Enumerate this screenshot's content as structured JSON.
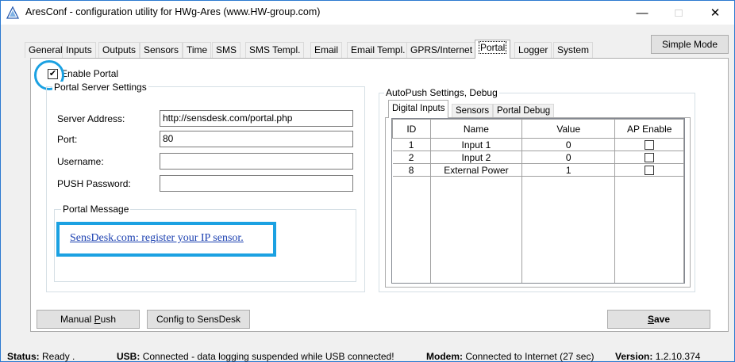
{
  "window": {
    "title": "AresConf - configuration utility for HWg-Ares (www.HW-group.com)"
  },
  "window_controls": {
    "minimize": "—",
    "maximize": "□",
    "close": "✕"
  },
  "tabs": [
    {
      "label": "General"
    },
    {
      "label": "Inputs"
    },
    {
      "label": "Outputs"
    },
    {
      "label": "Sensors"
    },
    {
      "label": "Time"
    },
    {
      "label": "SMS"
    },
    {
      "label": "SMS Templ."
    },
    {
      "label": "Email"
    },
    {
      "label": "Email Templ."
    },
    {
      "label": "GPRS/Internet"
    },
    {
      "label": "Portal",
      "active": true
    },
    {
      "label": "Logger"
    },
    {
      "label": "System"
    }
  ],
  "simple_mode_label": "Simple Mode",
  "portal": {
    "enable_label": "Enable Portal",
    "enable_checked": "☑",
    "server_settings_title": "Portal Server Settings",
    "fields": {
      "server_address": {
        "label": "Server Address:",
        "value": "http://sensdesk.com/portal.php"
      },
      "port": {
        "label": "Port:",
        "value": "80"
      },
      "username": {
        "label": "Username:",
        "value": ""
      },
      "push_password": {
        "label": "PUSH Password:",
        "value": ""
      }
    },
    "message_title": "Portal Message",
    "message_link": "SensDesk.com: register your IP sensor."
  },
  "autopush": {
    "title": "AutoPush Settings, Debug",
    "tabs": [
      {
        "label": "Digital Inputs",
        "active": true
      },
      {
        "label": "Sensors"
      },
      {
        "label": "Portal Debug"
      }
    ],
    "columns": [
      "ID",
      "Name",
      "Value",
      "AP Enable"
    ],
    "rows": [
      {
        "id": "1",
        "name": "Input 1",
        "value": "0",
        "ap_enable": false
      },
      {
        "id": "2",
        "name": "Input 2",
        "value": "0",
        "ap_enable": false
      },
      {
        "id": "8",
        "name": "External Power",
        "value": "1",
        "ap_enable": false
      }
    ]
  },
  "buttons": {
    "manual_push": {
      "pre": "Manual ",
      "ul": "P",
      "post": "ush"
    },
    "config_sensdesk": "Config to SensDesk",
    "save": {
      "ul": "S",
      "post": "ave"
    }
  },
  "status": {
    "status_label": "Status:",
    "status_value": "Ready .",
    "usb_label": "USB:",
    "usb_value": "Connected - data logging suspended while USB connected!",
    "modem_label": "Modem:",
    "modem_value": "Connected to Internet (27 sec)",
    "version_label": "Version:",
    "version_value": "1.2.10.374"
  },
  "colors": {
    "highlight": "#1ba1e2",
    "link": "#1a3fb0",
    "window_border": "#2b79d0"
  }
}
